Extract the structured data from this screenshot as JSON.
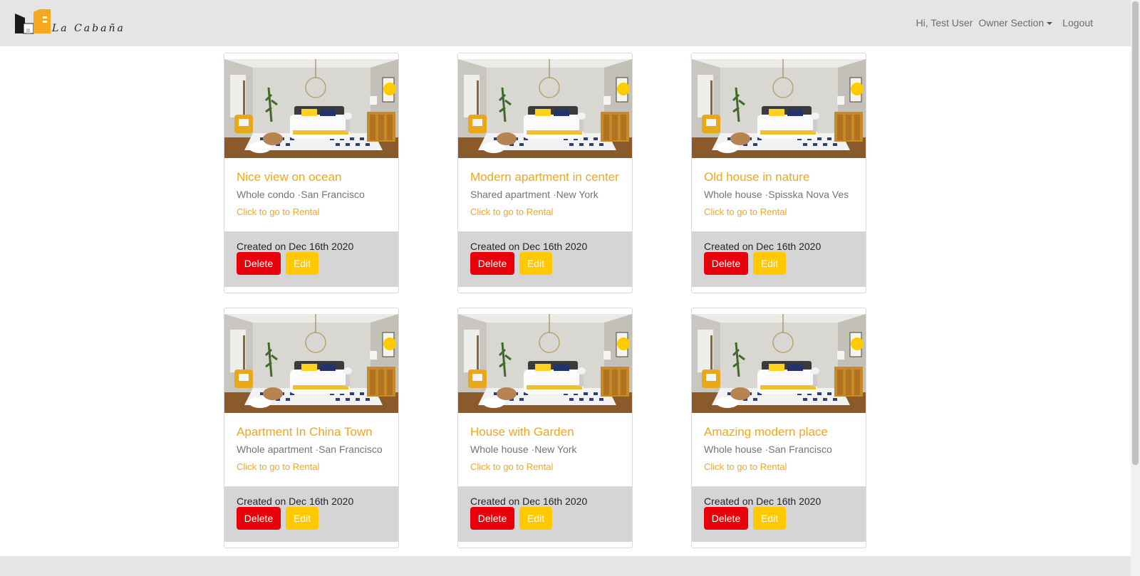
{
  "brand": {
    "name": "La Cabaña"
  },
  "nav": {
    "greeting": "Hi, Test User",
    "owner_section": "Owner Section",
    "logout": "Logout"
  },
  "colors": {
    "accent": "#f0a818",
    "delete": "#e8000b",
    "edit": "#ffc800",
    "navbar": "#e5e5e5",
    "card_footer": "#d5d5d5"
  },
  "rentals": [
    {
      "title": "Nice view on ocean",
      "type": "Whole condo",
      "city": "San Francisco",
      "link": "Click to go to Rental",
      "created": "Created on Dec 16th 2020",
      "delete": "Delete",
      "edit": "Edit"
    },
    {
      "title": "Modern apartment in center",
      "type": "Shared apartment",
      "city": "New York",
      "link": "Click to go to Rental",
      "created": "Created on Dec 16th 2020",
      "delete": "Delete",
      "edit": "Edit"
    },
    {
      "title": "Old house in nature",
      "type": "Whole house",
      "city": "Spisska Nova Ves",
      "link": "Click to go to Rental",
      "created": "Created on Dec 16th 2020",
      "delete": "Delete",
      "edit": "Edit"
    },
    {
      "title": "Apartment In China Town",
      "type": "Whole apartment",
      "city": "San Francisco",
      "link": "Click to go to Rental",
      "created": "Created on Dec 16th 2020",
      "delete": "Delete",
      "edit": "Edit"
    },
    {
      "title": "House with Garden",
      "type": "Whole house",
      "city": "New York",
      "link": "Click to go to Rental",
      "created": "Created on Dec 16th 2020",
      "delete": "Delete",
      "edit": "Edit"
    },
    {
      "title": "Amazing modern place",
      "type": "Whole house",
      "city": "San Francisco",
      "link": "Click to go to Rental",
      "created": "Created on Dec 16th 2020",
      "delete": "Delete",
      "edit": "Edit"
    }
  ]
}
